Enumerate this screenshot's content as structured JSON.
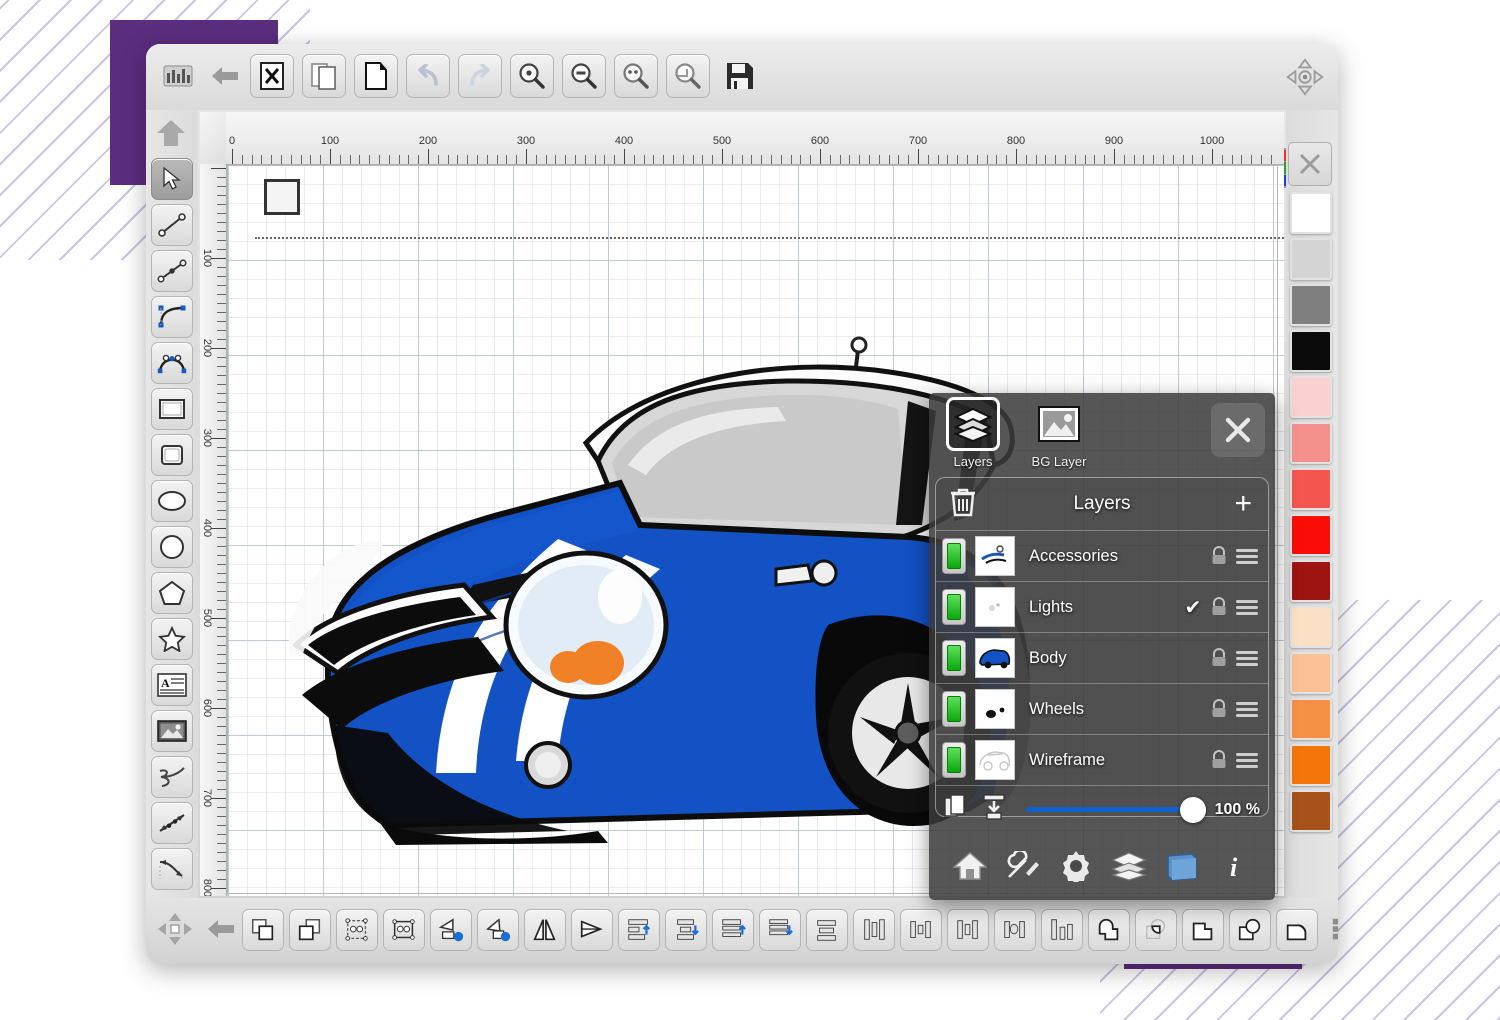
{
  "app": {
    "title": "Vector Drawing App",
    "canvas_background": "#ffffff",
    "accent_purple": "#5b2d7f"
  },
  "top_toolbar": {
    "items": [
      {
        "name": "app-logo-icon",
        "label": "App"
      },
      {
        "name": "back-arrow-icon",
        "label": "Back"
      },
      {
        "name": "close-document-icon",
        "label": "Close"
      },
      {
        "name": "copy-document-icon",
        "label": "Copy"
      },
      {
        "name": "new-document-icon",
        "label": "New"
      },
      {
        "name": "undo-icon",
        "label": "Undo"
      },
      {
        "name": "redo-icon",
        "label": "Redo"
      },
      {
        "name": "zoom-in-icon",
        "label": "Zoom In"
      },
      {
        "name": "zoom-out-icon",
        "label": "Zoom Out"
      },
      {
        "name": "zoom-actual-icon",
        "label": "Zoom 1:1"
      },
      {
        "name": "zoom-fit-icon",
        "label": "Zoom Fit"
      },
      {
        "name": "save-icon",
        "label": "Save"
      }
    ]
  },
  "nav_cluster": {
    "pan_label": "Pan",
    "up_label": "Up",
    "swatch_colors": [
      "#e8322a",
      "#f07a2a",
      "#f2e732",
      "#28a02a",
      "#7bd06a",
      "#d6efb6",
      "#1a42c8",
      "#5ba3e8",
      "#c3d8f0"
    ]
  },
  "left_tools": [
    {
      "name": "select-tool",
      "label": "Select",
      "active": true
    },
    {
      "name": "line-tool",
      "label": "Line",
      "active": false
    },
    {
      "name": "polyline-tool",
      "label": "Polyline",
      "active": false
    },
    {
      "name": "arc-tool",
      "label": "Arc",
      "active": false
    },
    {
      "name": "bezier-tool",
      "label": "Bezier Curve",
      "active": false
    },
    {
      "name": "rectangle-tool",
      "label": "Rectangle",
      "active": false
    },
    {
      "name": "rounded-rectangle-tool",
      "label": "Rounded Rectangle",
      "active": false
    },
    {
      "name": "ellipse-tool",
      "label": "Ellipse",
      "active": false
    },
    {
      "name": "circle-tool",
      "label": "Circle",
      "active": false
    },
    {
      "name": "polygon-tool",
      "label": "Polygon",
      "active": false
    },
    {
      "name": "star-tool",
      "label": "Star",
      "active": false
    },
    {
      "name": "text-tool",
      "label": "Text",
      "active": false
    },
    {
      "name": "image-tool",
      "label": "Image",
      "active": false
    },
    {
      "name": "freehand-tool",
      "label": "Freehand",
      "active": false
    },
    {
      "name": "dimension-tool",
      "label": "Dimension",
      "active": false
    },
    {
      "name": "curved-dimension-tool",
      "label": "Curved Dimension",
      "active": false
    }
  ],
  "color_palette": {
    "no_color_label": "No Color",
    "swatches": [
      {
        "name": "white",
        "hex": "#ffffff"
      },
      {
        "name": "light-gray",
        "hex": "#d4d4d4"
      },
      {
        "name": "gray",
        "hex": "#7f7f7f"
      },
      {
        "name": "black",
        "hex": "#0a0a0a"
      },
      {
        "name": "pale-pink",
        "hex": "#f9d0cd"
      },
      {
        "name": "pink",
        "hex": "#f3928c"
      },
      {
        "name": "salmon-red",
        "hex": "#f4554f"
      },
      {
        "name": "red",
        "hex": "#fa0d07"
      },
      {
        "name": "dark-red",
        "hex": "#9d1410"
      },
      {
        "name": "cream",
        "hex": "#fce0c6"
      },
      {
        "name": "peach",
        "hex": "#f9c195"
      },
      {
        "name": "light-orange",
        "hex": "#f59145"
      },
      {
        "name": "orange",
        "hex": "#f4760b"
      },
      {
        "name": "brown",
        "hex": "#a6521a"
      }
    ]
  },
  "bottom_toolbar": {
    "left_items": [
      {
        "name": "move-pad-icon",
        "label": "Move"
      },
      {
        "name": "back-arrow-icon",
        "label": "Back"
      }
    ],
    "items": [
      {
        "name": "bring-to-front-icon",
        "label": "Bring To Front"
      },
      {
        "name": "send-to-back-icon",
        "label": "Send To Back"
      },
      {
        "name": "group-icon",
        "label": "Group"
      },
      {
        "name": "ungroup-icon",
        "label": "Ungroup"
      },
      {
        "name": "rotate-left-icon",
        "label": "Rotate Left"
      },
      {
        "name": "rotate-right-icon",
        "label": "Rotate Right"
      },
      {
        "name": "flip-horizontal-icon",
        "label": "Flip Horizontal"
      },
      {
        "name": "flip-vertical-icon",
        "label": "Flip Vertical"
      },
      {
        "name": "align-left-icon",
        "label": "Align Left"
      },
      {
        "name": "align-center-vertical-icon",
        "label": "Align Center"
      },
      {
        "name": "align-right-icon",
        "label": "Align Right"
      },
      {
        "name": "align-justify-icon",
        "label": "Justify"
      },
      {
        "name": "align-top-icon",
        "label": "Align Top"
      },
      {
        "name": "align-middle-icon",
        "label": "Align Middle"
      },
      {
        "name": "align-bottom-icon",
        "label": "Align Bottom"
      },
      {
        "name": "distribute-horizontal-icon",
        "label": "Distribute Horizontally"
      },
      {
        "name": "distribute-vertical-icon",
        "label": "Distribute Vertically"
      },
      {
        "name": "distribute-spacing-icon",
        "label": "Distribute Spacing"
      },
      {
        "name": "union-icon",
        "label": "Union"
      },
      {
        "name": "intersect-icon",
        "label": "Intersect"
      },
      {
        "name": "subtract-icon",
        "label": "Subtract"
      },
      {
        "name": "exclude-icon",
        "label": "Exclude"
      },
      {
        "name": "divide-icon",
        "label": "Divide"
      },
      {
        "name": "grid-icon",
        "label": "Grid"
      }
    ]
  },
  "canvas": {
    "ruler_h_labels": [
      "0",
      "100",
      "200",
      "300",
      "400",
      "500",
      "600",
      "700",
      "800",
      "900",
      "1000"
    ],
    "ruler_v_labels": [
      "100",
      "200",
      "300",
      "400",
      "500",
      "600",
      "700",
      "800"
    ],
    "artwork_name": "Blue Mini Cooper Illustration"
  },
  "layers_panel": {
    "tabs": [
      {
        "name": "layers-tab",
        "label": "Layers",
        "icon": "layers-stack-icon",
        "selected": true
      },
      {
        "name": "bg-layer-tab",
        "label": "BG Layer",
        "icon": "image-icon",
        "selected": false
      }
    ],
    "close_label": "✕",
    "title": "Layers",
    "add_label": "+",
    "trash_label": "Delete Layer",
    "layers": [
      {
        "name": "Accessories",
        "visible": true,
        "selected": false,
        "locked": false
      },
      {
        "name": "Lights",
        "visible": true,
        "selected": true,
        "locked": false
      },
      {
        "name": "Body",
        "visible": true,
        "selected": false,
        "locked": false
      },
      {
        "name": "Wheels",
        "visible": true,
        "selected": false,
        "locked": false
      },
      {
        "name": "Wireframe",
        "visible": true,
        "selected": false,
        "locked": false
      }
    ],
    "opacity": {
      "value": "100 %",
      "percent": 100,
      "duplicate_label": "Duplicate Layer",
      "merge_label": "Merge Down"
    },
    "nav": [
      {
        "name": "home-icon",
        "label": "Home"
      },
      {
        "name": "tools-icon",
        "label": "Tools"
      },
      {
        "name": "settings-gear-icon",
        "label": "Settings"
      },
      {
        "name": "layers-icon",
        "label": "Layers"
      },
      {
        "name": "swatch-book-icon",
        "label": "Colors"
      },
      {
        "name": "info-icon",
        "label": "Info"
      }
    ]
  }
}
